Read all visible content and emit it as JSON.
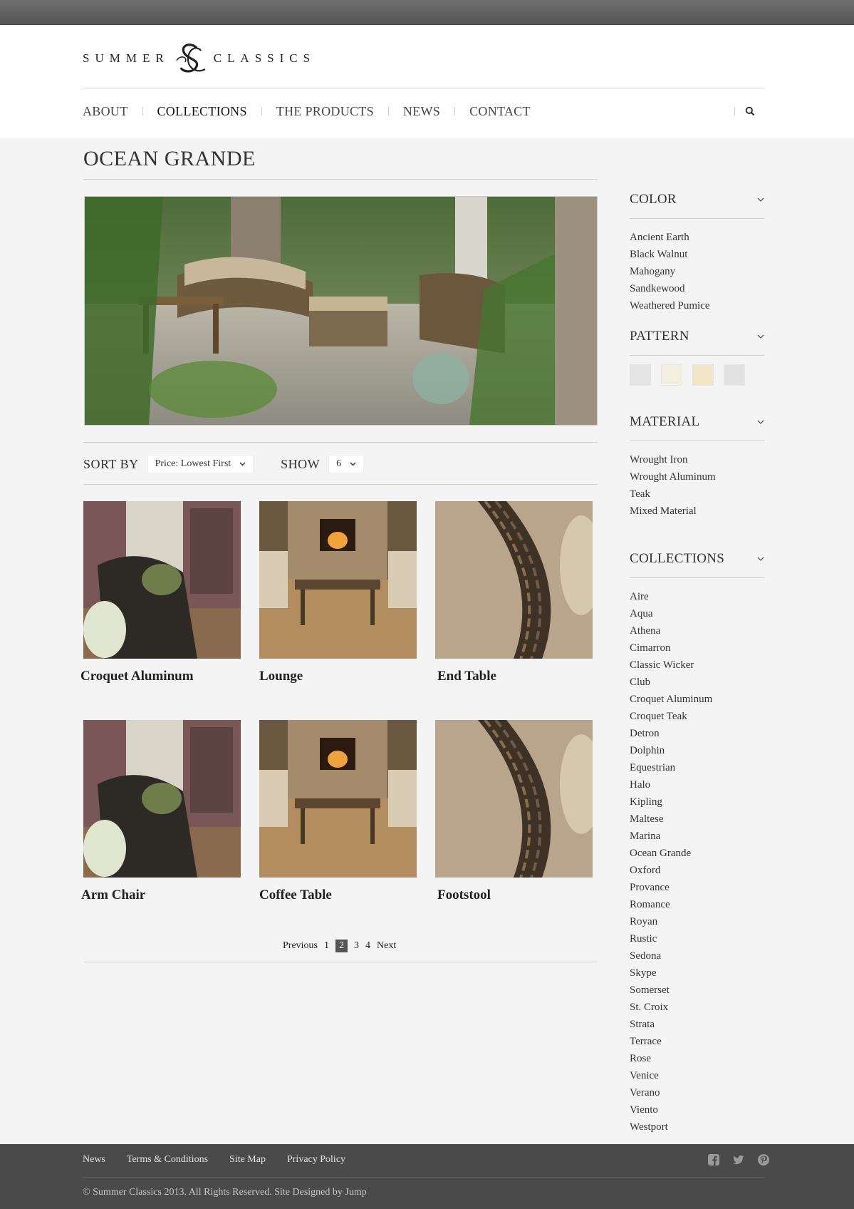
{
  "brand": {
    "word_left": "SUMMER",
    "word_right": "CLASSICS",
    "colors": {
      "text": "#222222",
      "footer_bg": "#4a4a4a",
      "top_bar": "#606060"
    }
  },
  "nav": {
    "items": [
      "ABOUT",
      "COLLECTIONS",
      "THE PRODUCTS",
      "NEWS",
      "CONTACT"
    ],
    "active": "COLLECTIONS",
    "search_icon": "search-icon"
  },
  "page": {
    "title": "OCEAN GRANDE"
  },
  "sort": {
    "label": "SORT BY",
    "value": "Price: Lowest First",
    "show_label": "SHOW",
    "show_value": "6"
  },
  "products": [
    {
      "name": "Croquet Aluminum",
      "image": "wicker-porch-chair"
    },
    {
      "name": "Lounge",
      "image": "fireplace-lounge"
    },
    {
      "name": "End Table",
      "image": "mosaic-tile-table"
    },
    {
      "name": "Arm Chair",
      "image": "wicker-porch-chair"
    },
    {
      "name": "Coffee Table",
      "image": "fireplace-lounge"
    },
    {
      "name": "Footstool",
      "image": "mosaic-tile-table"
    }
  ],
  "pagination": {
    "previous": "Previous",
    "pages": [
      "1",
      "2",
      "3",
      "4"
    ],
    "current": "2",
    "next": "Next"
  },
  "sidebar": {
    "color": {
      "title": "COLOR",
      "items": [
        "Ancient Earth",
        "Black Walnut",
        "Mahogany",
        "Sandkewood",
        "Weathered Pumice"
      ]
    },
    "pattern": {
      "title": "PATTERN",
      "swatches": [
        "#e4e4e4",
        "#f2efe0",
        "#f1e6c6",
        "#e2e2e2"
      ]
    },
    "material": {
      "title": "MATERIAL",
      "items": [
        "Wrought Iron",
        "Wrought Aluminum",
        "Teak",
        "Mixed Material"
      ]
    },
    "collections": {
      "title": "COLLECTIONS",
      "items": [
        "Aire",
        "Aqua",
        "Athena",
        "Cimarron",
        "Classic Wicker",
        "Club",
        "Croquet Aluminum",
        "Croquet Teak",
        "Detron",
        "Dolphin",
        "Equestrian",
        "Halo",
        "Kipling",
        "Maltese",
        "Marina",
        "Ocean Grande",
        "Oxford",
        "Provance",
        "Romance",
        "Royan",
        "Rustic",
        "Sedona",
        "Skype",
        "Somerset",
        "St. Croix",
        "Strata",
        "Terrace",
        "Rose",
        "Venice",
        "Verano",
        "Viento",
        "Westport"
      ]
    }
  },
  "footer": {
    "links": [
      "News",
      "Terms & Conditions",
      "Site Map",
      "Privacy Policy"
    ],
    "social": [
      "facebook-icon",
      "twitter-icon",
      "pinterest-icon"
    ],
    "copyright": "© Summer Classics 2013. All Rights Reserved. Site Designed by Jump"
  }
}
